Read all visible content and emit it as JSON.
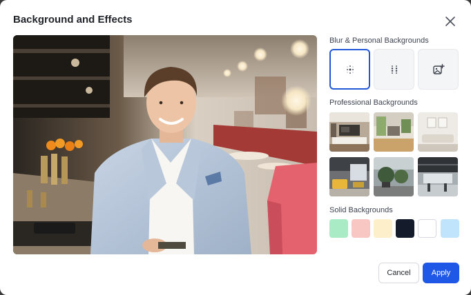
{
  "dialog": {
    "title": "Background and Effects",
    "close_icon": "close-icon"
  },
  "preview": {
    "image": "preview-photo"
  },
  "blur_section": {
    "label": "Blur & Personal Backgrounds",
    "options": [
      {
        "name": "slight-blur",
        "icon": "slight-blur-icon",
        "selected": true
      },
      {
        "name": "blur",
        "icon": "blur-icon",
        "selected": false
      },
      {
        "name": "upload-image",
        "icon": "add-image-icon",
        "selected": false
      }
    ]
  },
  "professional_section": {
    "label": "Professional Backgrounds",
    "items": [
      "living-room",
      "office-lobby",
      "white-lounge",
      "yellow-lounge",
      "atrium-plants",
      "open-office"
    ]
  },
  "solid_section": {
    "label": "Solid Backgrounds",
    "colors": [
      "#a8ebc4",
      "#f9c7c3",
      "#fdefc9",
      "#141c2b",
      "#ffffff",
      "#bfe4fb"
    ]
  },
  "footer": {
    "cancel_label": "Cancel",
    "apply_label": "Apply"
  },
  "colors": {
    "accent": "#1f57e6"
  }
}
